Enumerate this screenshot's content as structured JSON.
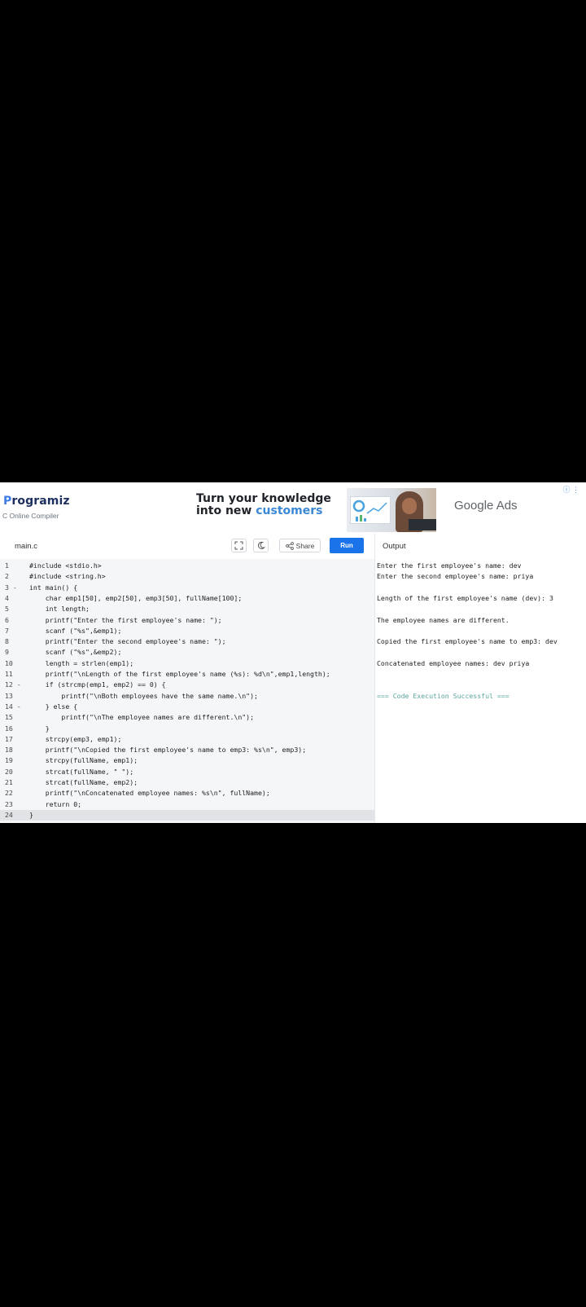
{
  "header": {
    "logo_text": "rogramiz",
    "logo_initial": "P",
    "subtitle": "C Online Compiler"
  },
  "ad": {
    "line1": "Turn your knowledge",
    "line2_plain": "into new ",
    "line2_highlight": "customers",
    "brand": "Google Ads",
    "marker": "ⓘ ⋮"
  },
  "toolbar": {
    "file_name": "main.c",
    "fullscreen_icon": "fullscreen-icon",
    "theme_icon": "moon-icon",
    "share_label": "Share",
    "run_label": "Run",
    "output_label": "Output"
  },
  "editor": {
    "lines": [
      {
        "n": "1",
        "code": "#include <stdio.h>"
      },
      {
        "n": "2",
        "code": "#include <string.h>"
      },
      {
        "n": "3 -",
        "code": "int main() {"
      },
      {
        "n": "4",
        "code": "    char emp1[50], emp2[50], emp3[50], fullName[100];"
      },
      {
        "n": "5",
        "code": "    int length;"
      },
      {
        "n": "6",
        "code": "    printf(\"Enter the first employee's name: \");"
      },
      {
        "n": "7",
        "code": "    scanf (\"%s\",&emp1);"
      },
      {
        "n": "8",
        "code": "    printf(\"Enter the second employee's name: \");"
      },
      {
        "n": "9",
        "code": "    scanf (\"%s\",&emp2);"
      },
      {
        "n": "10",
        "code": "    length = strlen(emp1);"
      },
      {
        "n": "11",
        "code": "    printf(\"\\nLength of the first employee's name (%s): %d\\n\",emp1,length);"
      },
      {
        "n": "12 -",
        "code": "    if (strcmp(emp1, emp2) == 0) {"
      },
      {
        "n": "13",
        "code": "        printf(\"\\nBoth employees have the same name.\\n\");"
      },
      {
        "n": "14 -",
        "code": "    } else {"
      },
      {
        "n": "15",
        "code": "        printf(\"\\nThe employee names are different.\\n\");"
      },
      {
        "n": "16",
        "code": "    }"
      },
      {
        "n": "17",
        "code": "    strcpy(emp3, emp1);"
      },
      {
        "n": "18",
        "code": "    printf(\"\\nCopied the first employee's name to emp3: %s\\n\", emp3);"
      },
      {
        "n": "19",
        "code": "    strcpy(fullName, emp1);"
      },
      {
        "n": "20",
        "code": "    strcat(fullName, \" \");"
      },
      {
        "n": "21",
        "code": "    strcat(fullName, emp2);"
      },
      {
        "n": "22",
        "code": "    printf(\"\\nConcatenated employee names: %s\\n\", fullName);"
      },
      {
        "n": "23",
        "code": "    return 0;"
      },
      {
        "n": "24",
        "code": "}"
      }
    ]
  },
  "output": {
    "lines": [
      "Enter the first employee's name: dev",
      "Enter the second employee's name: priya",
      "",
      "Length of the first employee's name (dev): 3",
      "",
      "The employee names are different.",
      "",
      "Copied the first employee's name to emp3: dev",
      "",
      "Concatenated employee names: dev priya",
      "",
      "",
      "=== Code Execution Successful ==="
    ]
  }
}
